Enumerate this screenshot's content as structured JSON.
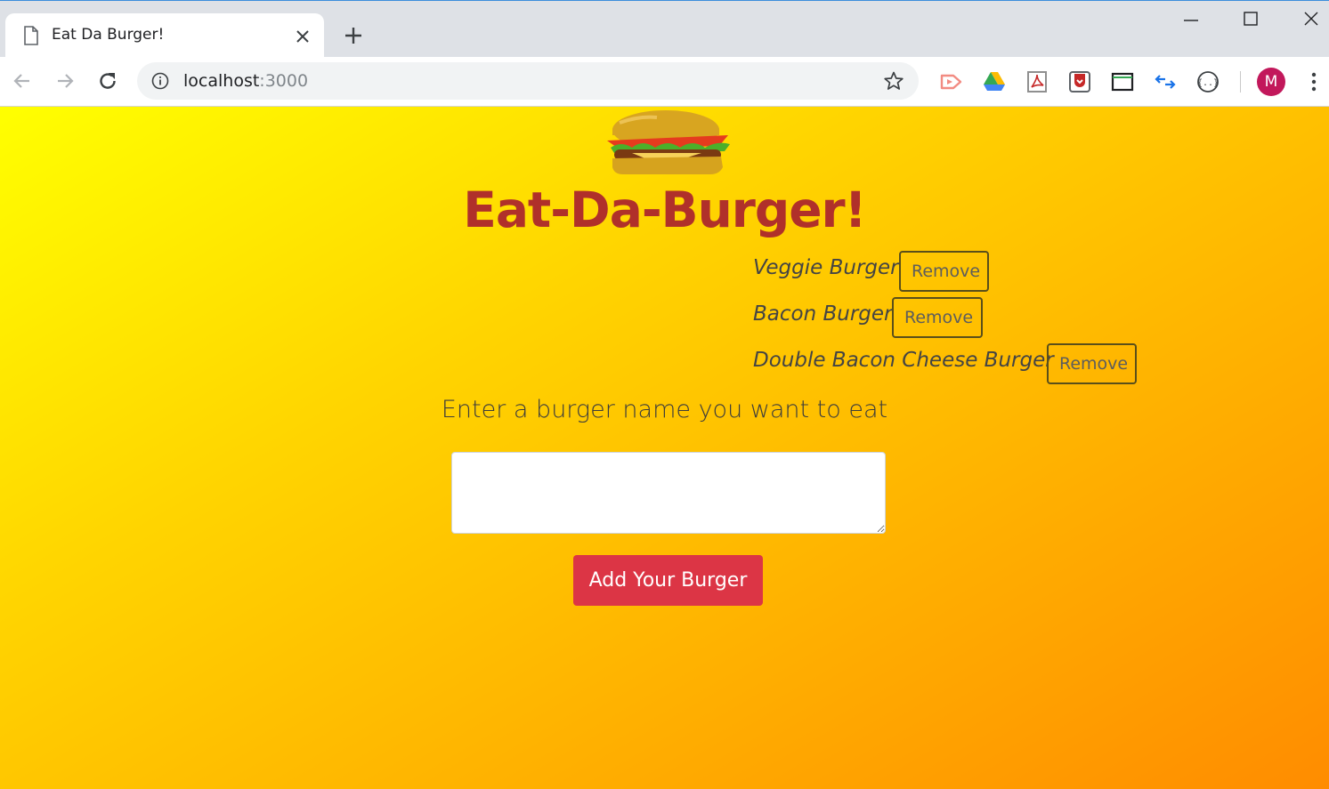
{
  "browser": {
    "tab_title": "Eat Da Burger!",
    "url_host": "localhost",
    "url_port": ":3000",
    "profile_initial": "M"
  },
  "page": {
    "heading": "Eat-Da-Burger!",
    "burgers": [
      {
        "name": "Veggie Burger",
        "button": "Remove"
      },
      {
        "name": "Bacon Burger",
        "button": "Remove"
      },
      {
        "name": "Double Bacon Cheese Burger",
        "button": "Remove"
      }
    ],
    "prompt": "Enter a burger name you want to eat",
    "input_value": "",
    "add_button": "Add Your Burger"
  },
  "colors": {
    "heading": "#b0302a",
    "add_button": "#dc3545",
    "gradient_start": "#ffff00",
    "gradient_end": "#ff8c00"
  },
  "icons": [
    "page-icon",
    "close-icon",
    "plus-icon",
    "minimize-icon",
    "maximize-icon",
    "window-close-icon",
    "back-arrow-icon",
    "forward-arrow-icon",
    "reload-icon",
    "info-icon",
    "star-icon",
    "cast-extension-icon",
    "drive-icon",
    "pdf-extension-icon",
    "pocket-extension-icon",
    "screenshot-extension-icon",
    "sync-extension-icon",
    "json-extension-icon",
    "kebab-menu-icon",
    "burger-logo"
  ]
}
